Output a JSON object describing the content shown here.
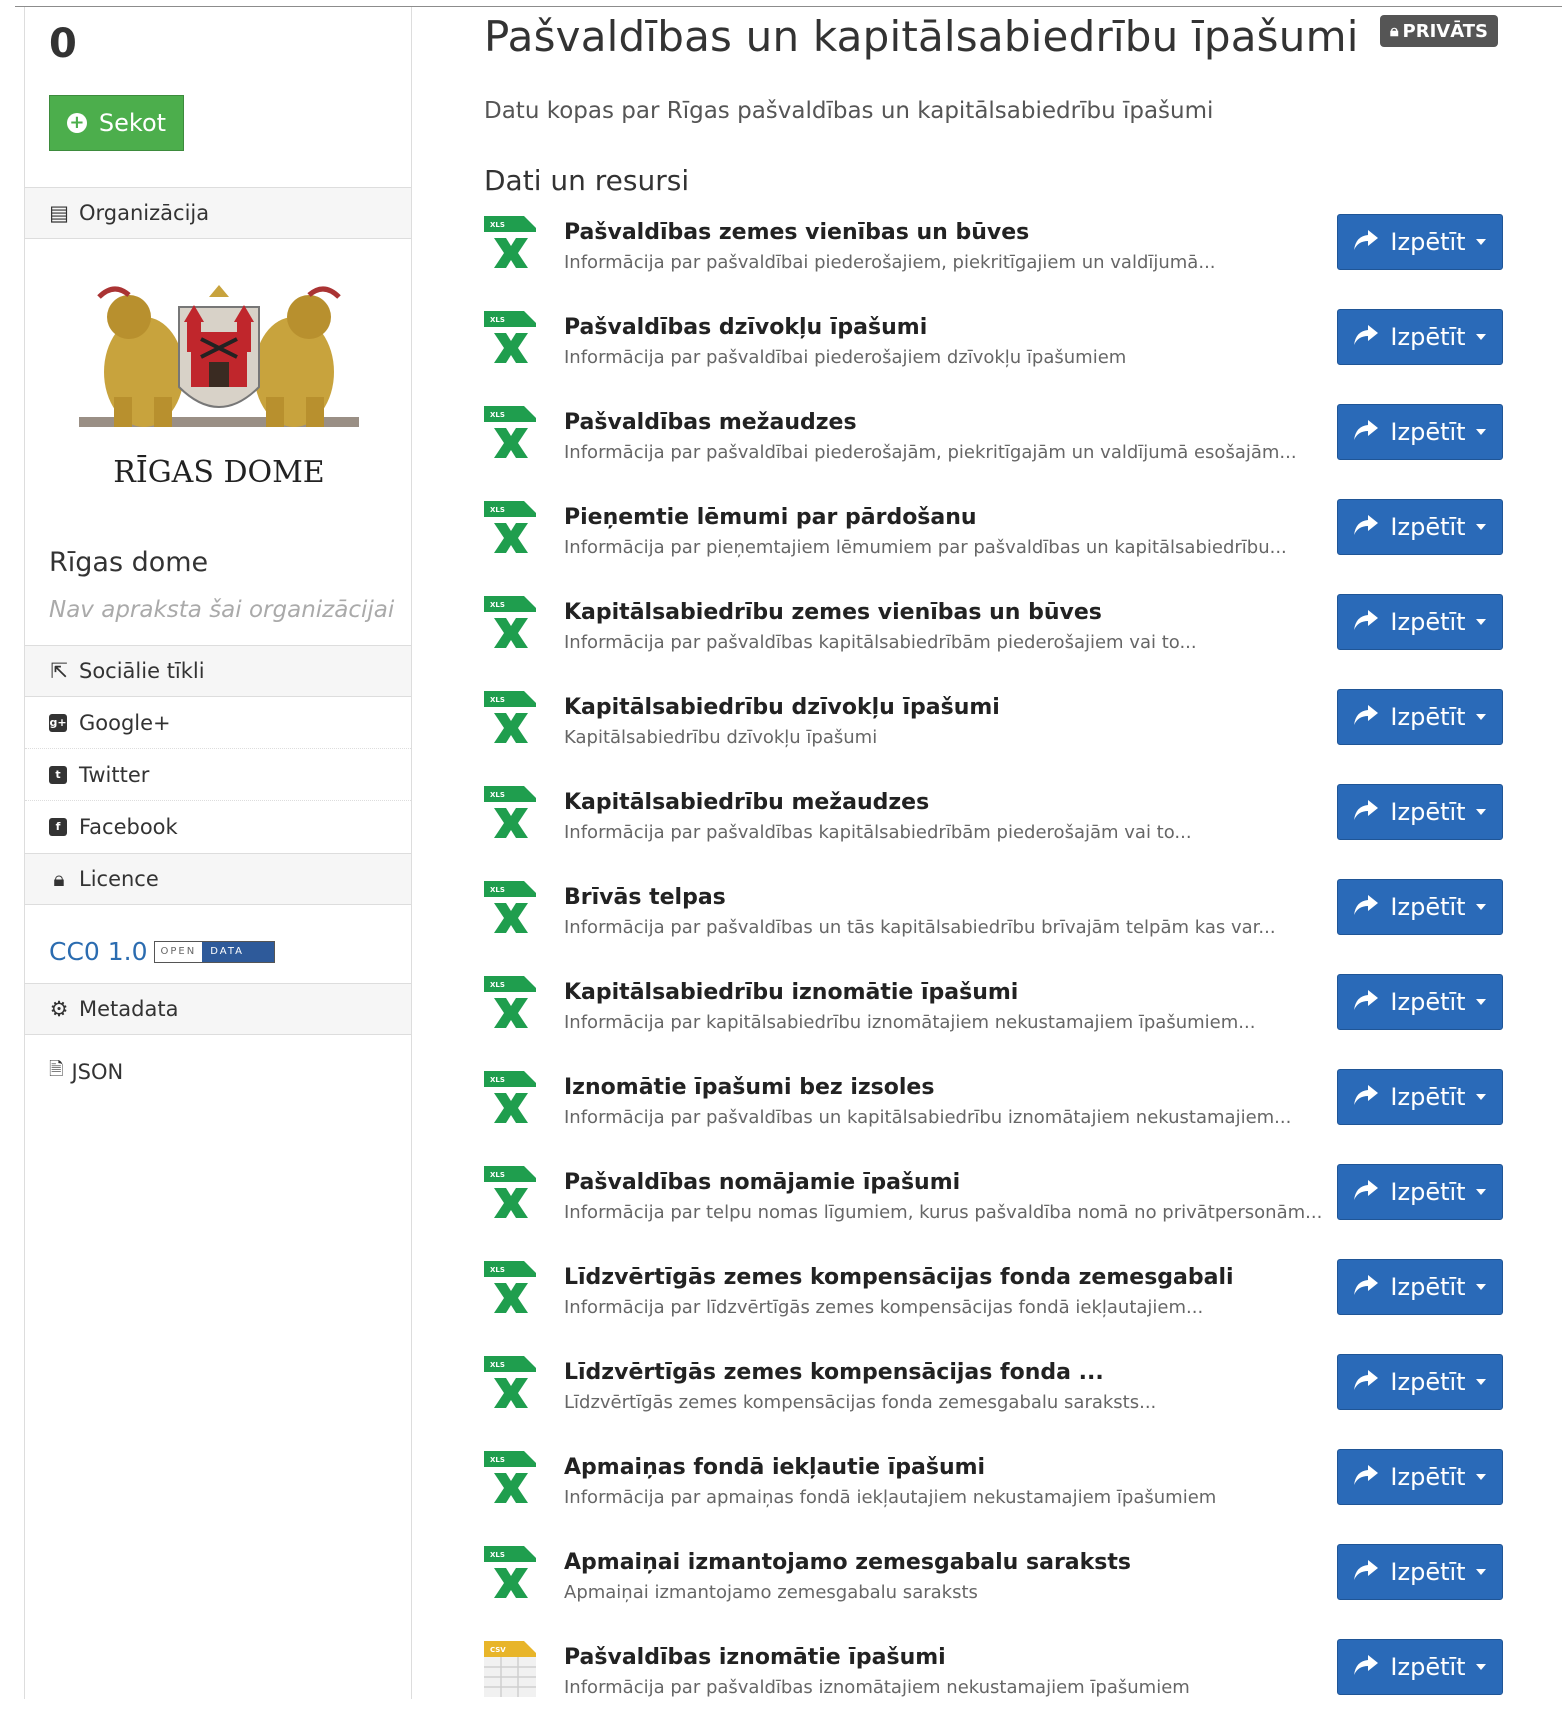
{
  "sidebar": {
    "followers_count": "0",
    "follow_label": "Sekot",
    "organization_heading": "Organizācija",
    "org_logo_text": "RĪGAS DOME",
    "org_name": "Rīgas dome",
    "org_description": "Nav apraksta šai organizācijai",
    "social_heading": "Sociālie tīkli",
    "social_links": [
      {
        "label": "Google+",
        "icon": "google-plus-icon"
      },
      {
        "label": "Twitter",
        "icon": "twitter-icon"
      },
      {
        "label": "Facebook",
        "icon": "facebook-icon"
      }
    ],
    "licence_heading": "Licence",
    "licence_name": "CC0 1.0",
    "licence_badge": {
      "left": "OPEN",
      "right": "DATA"
    },
    "metadata_heading": "Metadata",
    "json_label": "JSON"
  },
  "dataset": {
    "title": "Pašvaldības un kapitālsabiedrību īpašumi",
    "private_badge": "PRIVĀTS",
    "description": "Datu kopas par Rīgas pašvaldības un kapitālsabiedrību īpašumi"
  },
  "resources": {
    "heading": "Dati un resursi",
    "explore_label": "Izpētīt",
    "items": [
      {
        "title": "Pašvaldības zemes vienības un būves",
        "description": "Informācija par pašvaldībai piederošajiem, piekritīgajiem un valdījumā...",
        "format": "XLS"
      },
      {
        "title": "Pašvaldības dzīvokļu īpašumi",
        "description": "Informācija par pašvaldībai piederošajiem dzīvokļu īpašumiem",
        "format": "XLS"
      },
      {
        "title": "Pašvaldības mežaudzes",
        "description": "Informācija par pašvaldībai piederošajām, piekritīgajām un valdījumā esošajām...",
        "format": "XLS"
      },
      {
        "title": "Pieņemtie lēmumi par pārdošanu",
        "description": "Informācija par pieņemtajiem lēmumiem par pašvaldības un kapitālsabiedrību...",
        "format": "XLS"
      },
      {
        "title": "Kapitālsabiedrību zemes vienības un būves",
        "description": "Informācija par pašvaldības kapitālsabiedrībām piederošajiem vai to...",
        "format": "XLS"
      },
      {
        "title": "Kapitālsabiedrību dzīvokļu īpašumi",
        "description": "Kapitālsabiedrību dzīvokļu īpašumi",
        "format": "XLS"
      },
      {
        "title": "Kapitālsabiedrību mežaudzes",
        "description": "Informācija par pašvaldības kapitālsabiedrībām piederošajām vai to...",
        "format": "XLS"
      },
      {
        "title": "Brīvās telpas",
        "description": "Informācija par pašvaldības un tās kapitālsabiedrību brīvajām telpām kas var...",
        "format": "XLS"
      },
      {
        "title": "Kapitālsabiedrību iznomātie īpašumi",
        "description": "Informācija par kapitālsabiedrību iznomātajiem nekustamajiem īpašumiem...",
        "format": "XLS"
      },
      {
        "title": "Iznomātie īpašumi bez izsoles",
        "description": "Informācija par pašvaldības un kapitālsabiedrību iznomātajiem nekustamajiem...",
        "format": "XLS"
      },
      {
        "title": "Pašvaldības nomājamie īpašumi",
        "description": "Informācija par telpu nomas līgumiem, kurus pašvaldība nomā no privātpersonām...",
        "format": "XLS"
      },
      {
        "title": "Līdzvērtīgās zemes kompensācijas fonda zemesgabali",
        "description": "Informācija par līdzvērtīgās zemes kompensācijas fondā iekļautajiem...",
        "format": "XLS"
      },
      {
        "title": "Līdzvērtīgās zemes kompensācijas fonda ...",
        "description": "Līdzvērtīgās zemes kompensācijas fonda zemesgabalu saraksts...",
        "format": "XLS"
      },
      {
        "title": "Apmaiņas fondā iekļautie īpašumi",
        "description": "Informācija par apmaiņas fondā iekļautajiem nekustamajiem īpašumiem",
        "format": "XLS"
      },
      {
        "title": "Apmaiņai izmantojamo zemesgabalu saraksts",
        "description": "Apmaiņai izmantojamo zemesgabalu saraksts",
        "format": "XLS"
      },
      {
        "title": "Pašvaldības iznomātie īpašumi",
        "description": "Informācija par pašvaldības iznomātajiem nekustamajiem īpašumiem",
        "format": "CSV"
      }
    ]
  },
  "colors": {
    "follow_button": "#4cae4c",
    "explore_button": "#2a6ab8",
    "private_badge": "#555555",
    "xls_icon": "#1f9e4e",
    "csv_icon": "#e8b52a",
    "link": "#2b6cb0"
  }
}
